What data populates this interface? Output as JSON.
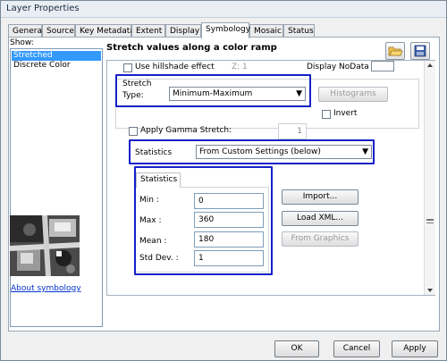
{
  "window": {
    "title": "Layer Properties"
  },
  "tabs": [
    "General",
    "Source",
    "Key Metadata",
    "Extent",
    "Display",
    "Symbology",
    "Mosaic",
    "Status"
  ],
  "active_tab": "Symbology",
  "left_panel": {
    "show_label": "Show:",
    "items": [
      "Stretched",
      "Discrete Color"
    ],
    "selected": "Stretched",
    "about_link": "About symbology"
  },
  "right_panel": {
    "title": "Stretch values along a color ramp",
    "hillshade_label": "Use hillshade effect",
    "hillshade_value": "Z: 1",
    "nodata_label": "Display NoData as",
    "stretch": {
      "group_label": "Stretch",
      "type_label": "Type:",
      "type_value": "Minimum-Maximum",
      "histograms_button": "Histograms",
      "invert_label": "Invert",
      "gamma_label": "Apply Gamma Stretch:",
      "gamma_value": "1"
    },
    "statistics": {
      "label": "Statistics",
      "value": "From Custom Settings (below)",
      "tab_label": "Statistics",
      "rows": [
        {
          "label": "Min :",
          "value": "0"
        },
        {
          "label": "Max :",
          "value": "360"
        },
        {
          "label": "Mean :",
          "value": "180"
        },
        {
          "label": "Std Dev. :",
          "value": "1"
        }
      ],
      "import_button": "Import...",
      "load_xml_button": "Load XML...",
      "from_graphics_button": "From Graphics"
    }
  },
  "footer": {
    "ok": "OK",
    "cancel": "Cancel",
    "apply": "Apply"
  },
  "colors": {
    "highlight_box": "#1520c8",
    "selection": "#3399ff",
    "link": "#0033cc"
  }
}
